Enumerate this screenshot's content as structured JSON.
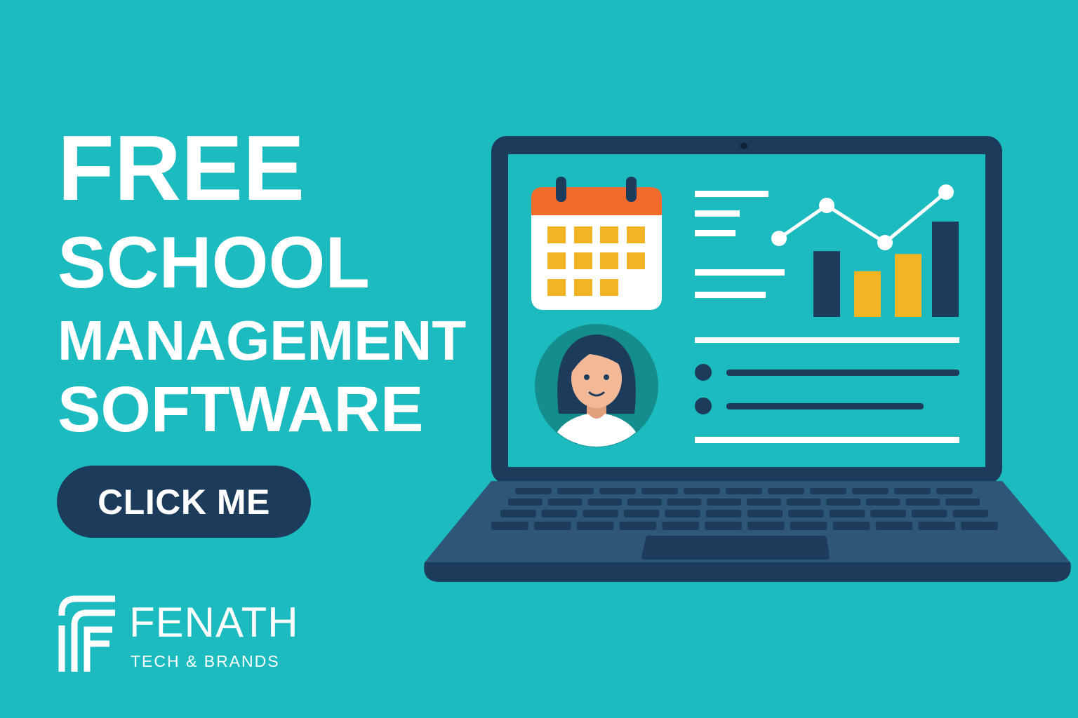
{
  "headline": {
    "line1": "FREE",
    "line2": "SCHOOL",
    "line3": "MANAGEMENT",
    "line4": "SOFTWARE"
  },
  "cta": {
    "label": "CLICK ME"
  },
  "brand": {
    "name": "FENATH",
    "tagline": "TECH & BRANDS",
    "logo_icon": "fenath-monogram-icon"
  },
  "illustration": {
    "device": "laptop-icon",
    "widgets": [
      "calendar-icon",
      "line-chart-icon",
      "bar-chart-icon",
      "avatar-icon",
      "text-lines-icon",
      "bullet-list-icon"
    ],
    "bar_chart_values": [
      0.69,
      0.48,
      0.66,
      1.0
    ]
  },
  "colors": {
    "background": "#1bbbc0",
    "navy": "#1d3c5b",
    "accent_orange": "#f26a2c",
    "accent_yellow": "#f0b424",
    "white": "#ffffff"
  }
}
